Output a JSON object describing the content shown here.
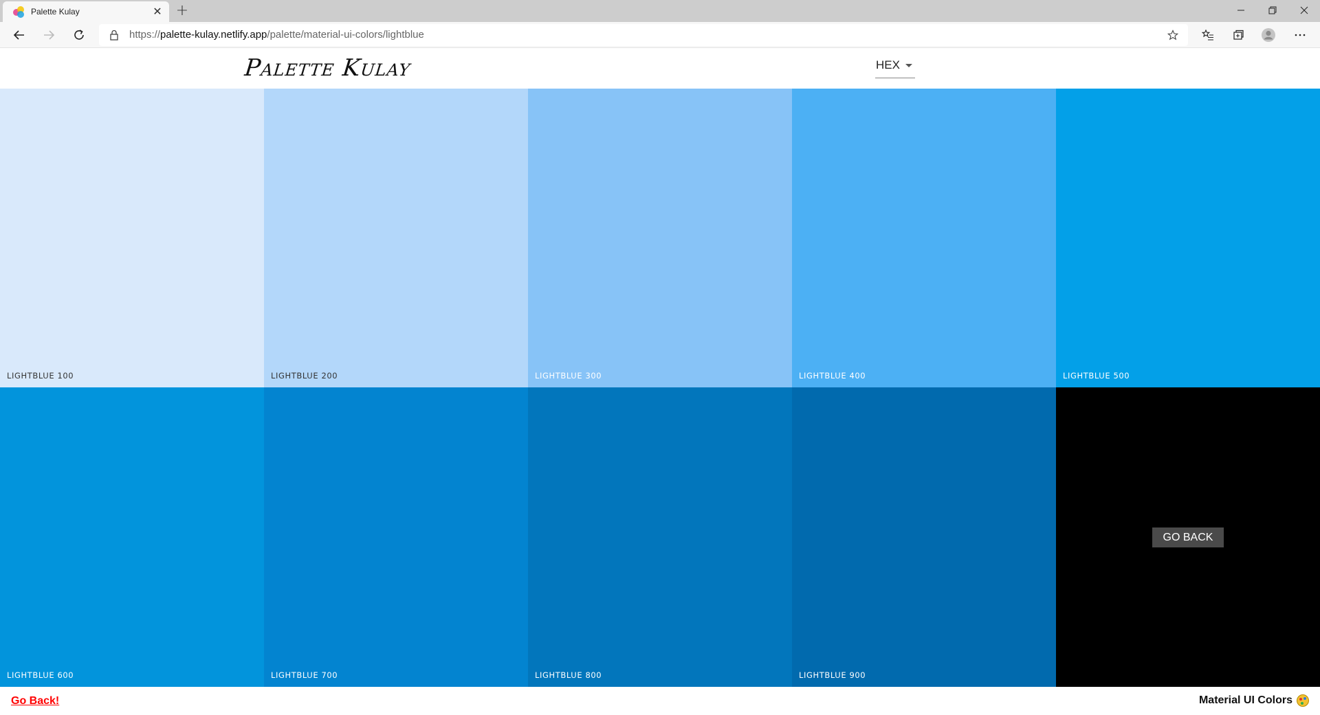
{
  "browser": {
    "tab_title": "Palette Kulay",
    "url_scheme": "https://",
    "url_host": "palette-kulay.netlify.app",
    "url_path": "/palette/material-ui-colors/lightblue"
  },
  "navbar": {
    "logo": "Palette Kulay",
    "format_selected": "HEX"
  },
  "palette": {
    "swatches": [
      {
        "name": "lightblue 100",
        "color": "#d9e9fb",
        "text_color": "#333333"
      },
      {
        "name": "lightblue 200",
        "color": "#b3d7fa",
        "text_color": "#333333"
      },
      {
        "name": "lightblue 300",
        "color": "#87c3f7",
        "text_color": "#ffffff"
      },
      {
        "name": "lightblue 400",
        "color": "#4cb0f4",
        "text_color": "#ffffff"
      },
      {
        "name": "lightblue 500",
        "color": "#03a0e8",
        "text_color": "#ffffff"
      },
      {
        "name": "lightblue 600",
        "color": "#0294dc",
        "text_color": "#ffffff"
      },
      {
        "name": "lightblue 700",
        "color": "#0384d0",
        "text_color": "#ffffff"
      },
      {
        "name": "lightblue 800",
        "color": "#0276bc",
        "text_color": "#ffffff"
      },
      {
        "name": "lightblue 900",
        "color": "#016aae",
        "text_color": "#ffffff"
      }
    ],
    "go_back_button": "Go Back"
  },
  "footer": {
    "go_back_link": "Go Back!",
    "palette_title": "Material UI Colors"
  }
}
